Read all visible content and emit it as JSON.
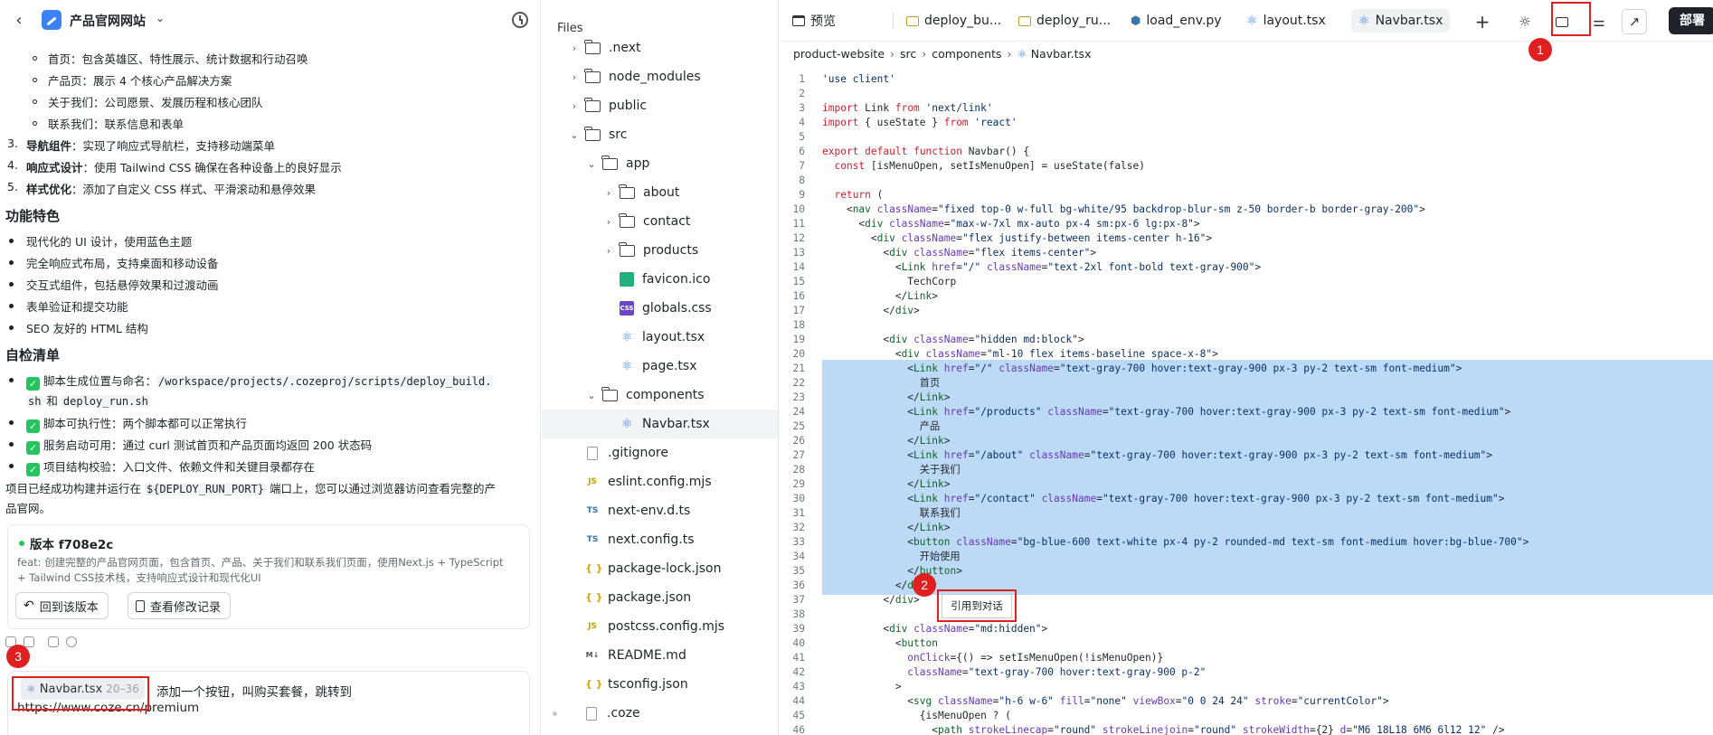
{
  "chat": {
    "title": "产品官网网站",
    "bullets_top": [
      "首页：包含英雄区、特性展示、统计数据和行动召唤",
      "产品页：展示 4 个核心产品解决方案",
      "关于我们：公司愿景、发展历程和核心团队",
      "联系我们：联系信息和表单"
    ],
    "numbered": [
      {
        "n": "3.",
        "bold": "导航组件",
        "text": "：实现了响应式导航栏，支持移动端菜单"
      },
      {
        "n": "4.",
        "bold": "响应式设计",
        "text": "：使用 Tailwind CSS 确保在各种设备上的良好显示"
      },
      {
        "n": "5.",
        "bold": "样式优化",
        "text": "：添加了自定义 CSS 样式、平滑滚动和悬停效果"
      }
    ],
    "features_heading": "功能特色",
    "features": [
      "现代化的 UI 设计，使用蓝色主题",
      "完全响应式布局，支持桌面和移动设备",
      "交互式组件，包括悬停效果和过渡动画",
      "表单验证和提交功能",
      "SEO 友好的 HTML 结构"
    ],
    "checklist_heading": "自检清单",
    "check1_prefix": "脚本生成位置与命名：",
    "check1_path": "/workspace/projects/.cozeproj/scripts/deploy_build.",
    "check1_path2": "sh",
    "check1_and": " 和 ",
    "check1_file2": "deploy_run.sh",
    "check2": "脚本可执行性：两个脚本都可以正常执行",
    "check3": "服务启动可用：通过 curl 测试首页和产品页面均返回 200 状态码",
    "check4": "项目结构校验：入口文件、依赖文件和关键目录都存在",
    "summary_a": "项目已经成功构建并运行在 ",
    "summary_var": "${DEPLOY_RUN_PORT}",
    "summary_b": " 端口上，您可以通过浏览器访问查看完整的产",
    "summary_c": "品官网。",
    "version": {
      "title": "版本 f708e2c",
      "desc": "feat: 创建完整的产品官网页面，包含首页、产品、关于我们和联系我们页面，使用Next.js + TypeScript + Tailwind CSS技术栈，支持响应式设计和现代化UI",
      "restore_label": "回到该版本",
      "changes_label": "查看修改记录"
    },
    "input": {
      "chip_file": "Navbar.tsx",
      "chip_range": "20–36",
      "message_a": "添加一个按钮，叫购买套餐，跳转到",
      "message_b": "https://www.coze.cn/premium"
    }
  },
  "files": {
    "header": "Files",
    "rows": [
      {
        "label": ".next",
        "type": "folder",
        "twisty": "›",
        "indent": 0
      },
      {
        "label": "node_modules",
        "type": "folder",
        "twisty": "›",
        "indent": 0
      },
      {
        "label": "public",
        "type": "folder",
        "twisty": "›",
        "indent": 0
      },
      {
        "label": "src",
        "type": "folder-open",
        "twisty": "⌄",
        "indent": 0
      },
      {
        "label": "app",
        "type": "folder-open",
        "twisty": "⌄",
        "indent": 1
      },
      {
        "label": "about",
        "type": "folder",
        "twisty": "›",
        "indent": 2
      },
      {
        "label": "contact",
        "type": "folder",
        "twisty": "›",
        "indent": 2
      },
      {
        "label": "products",
        "type": "folder",
        "twisty": "›",
        "indent": 2
      },
      {
        "label": "favicon.ico",
        "type": "img",
        "twisty": "",
        "indent": 2
      },
      {
        "label": "globals.css",
        "type": "css",
        "twisty": "",
        "indent": 2
      },
      {
        "label": "layout.tsx",
        "type": "react",
        "twisty": "",
        "indent": 2
      },
      {
        "label": "page.tsx",
        "type": "react",
        "twisty": "",
        "indent": 2
      },
      {
        "label": "components",
        "type": "folder-open",
        "twisty": "⌄",
        "indent": 1
      },
      {
        "label": "Navbar.tsx",
        "type": "react",
        "twisty": "",
        "indent": 2,
        "selected": true
      },
      {
        "label": ".gitignore",
        "type": "file",
        "twisty": "",
        "indent": 0
      },
      {
        "label": "eslint.config.mjs",
        "type": "js",
        "twisty": "",
        "indent": 0
      },
      {
        "label": "next-env.d.ts",
        "type": "ts",
        "twisty": "",
        "indent": 0
      },
      {
        "label": "next.config.ts",
        "type": "ts",
        "twisty": "",
        "indent": 0
      },
      {
        "label": "package-lock.json",
        "type": "json",
        "twisty": "",
        "indent": 0
      },
      {
        "label": "package.json",
        "type": "json",
        "twisty": "",
        "indent": 0
      },
      {
        "label": "postcss.config.mjs",
        "type": "js",
        "twisty": "",
        "indent": 0
      },
      {
        "label": "README.md",
        "type": "md",
        "twisty": "",
        "indent": 0
      },
      {
        "label": "tsconfig.json",
        "type": "json",
        "twisty": "",
        "indent": 0
      },
      {
        "label": ".coze",
        "type": "file",
        "twisty": "",
        "indent": -1
      }
    ]
  },
  "editor": {
    "tabs": [
      {
        "label": "预览",
        "icon": "preview-icon"
      },
      {
        "label": "deploy_bu...",
        "icon": "folder-icon"
      },
      {
        "label": "deploy_ru...",
        "icon": "folder-icon"
      },
      {
        "label": "load_env.py",
        "icon": "python-icon"
      },
      {
        "label": "layout.tsx",
        "icon": "react-icon"
      },
      {
        "label": "Navbar.tsx",
        "icon": "react-icon",
        "active": true
      }
    ],
    "deploy_label": "部署",
    "breadcrumb": [
      "product-website",
      "src",
      "components",
      "Navbar.tsx"
    ],
    "quote_label": "引用到对话",
    "highlight_from": 21,
    "highlight_to": 36,
    "lines": [
      "'use client'",
      "",
      "import Link from 'next/link'",
      "import { useState } from 'react'",
      "",
      "export default function Navbar() {",
      "  const [isMenuOpen, setIsMenuOpen] = useState(false)",
      "",
      "  return (",
      "    <nav className=\"fixed top-0 w-full bg-white/95 backdrop-blur-sm z-50 border-b border-gray-200\">",
      "      <div className=\"max-w-7xl mx-auto px-4 sm:px-6 lg:px-8\">",
      "        <div className=\"flex justify-between items-center h-16\">",
      "          <div className=\"flex items-center\">",
      "            <Link href=\"/\" className=\"text-2xl font-bold text-gray-900\">",
      "              TechCorp",
      "            </Link>",
      "          </div>",
      "",
      "          <div className=\"hidden md:block\">",
      "            <div className=\"ml-10 flex items-baseline space-x-8\">",
      "              <Link href=\"/\" className=\"text-gray-700 hover:text-gray-900 px-3 py-2 text-sm font-medium\">",
      "                首页",
      "              </Link>",
      "              <Link href=\"/products\" className=\"text-gray-700 hover:text-gray-900 px-3 py-2 text-sm font-medium\">",
      "                产品",
      "              </Link>",
      "              <Link href=\"/about\" className=\"text-gray-700 hover:text-gray-900 px-3 py-2 text-sm font-medium\">",
      "                关于我们",
      "              </Link>",
      "              <Link href=\"/contact\" className=\"text-gray-700 hover:text-gray-900 px-3 py-2 text-sm font-medium\">",
      "                联系我们",
      "              </Link>",
      "              <button className=\"bg-blue-600 text-white px-4 py-2 rounded-md text-sm font-medium hover:bg-blue-700\">",
      "                开始使用",
      "              </button>",
      "            </div>",
      "          </div>",
      "",
      "          <div className=\"md:hidden\">",
      "            <button",
      "              onClick={() => setIsMenuOpen(!isMenuOpen)}",
      "              className=\"text-gray-700 hover:text-gray-900 p-2\"",
      "            >",
      "              <svg className=\"h-6 w-6\" fill=\"none\" viewBox=\"0 0 24 24\" stroke=\"currentColor\">",
      "                {isMenuOpen ? (",
      "                  <path strokeLinecap=\"round\" strokeLinejoin=\"round\" strokeWidth={2} d=\"M6 18L18 6M6 6l12 12\" />"
    ]
  },
  "annotations": [
    "1",
    "2",
    "3"
  ]
}
